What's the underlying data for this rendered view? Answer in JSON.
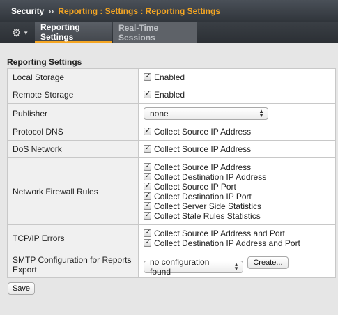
{
  "breadcrumb": {
    "root": "Security",
    "separator": "››",
    "path": "Reporting : Settings : Reporting Settings"
  },
  "tabs": [
    {
      "label": "Reporting Settings",
      "active": true
    },
    {
      "label": "Real-Time Sessions",
      "active": false
    }
  ],
  "section_title": "Reporting Settings",
  "rows": {
    "local_storage": {
      "label": "Local Storage",
      "options": [
        "Enabled"
      ]
    },
    "remote_storage": {
      "label": "Remote Storage",
      "options": [
        "Enabled"
      ]
    },
    "publisher": {
      "label": "Publisher",
      "value": "none"
    },
    "protocol_dns": {
      "label": "Protocol DNS",
      "options": [
        "Collect Source IP Address"
      ]
    },
    "dos_network": {
      "label": "DoS Network",
      "options": [
        "Collect Source IP Address"
      ]
    },
    "network_firewall": {
      "label": "Network Firewall Rules",
      "options": [
        "Collect Source IP Address",
        "Collect Destination IP Address",
        "Collect Source IP Port",
        "Collect Destination IP Port",
        "Collect Server Side Statistics",
        "Collect Stale Rules Statistics"
      ]
    },
    "tcpip_errors": {
      "label": "TCP/IP Errors",
      "options": [
        "Collect Source IP Address and Port",
        "Collect Destination IP Address and Port"
      ]
    },
    "smtp": {
      "label_line1": "SMTP Configuration for Reports",
      "label_line2": "Export",
      "value": "no configuration found",
      "create_label": "Create..."
    }
  },
  "save_label": "Save",
  "colors": {
    "accent": "#f5a623",
    "header_bg": "#30353b"
  }
}
